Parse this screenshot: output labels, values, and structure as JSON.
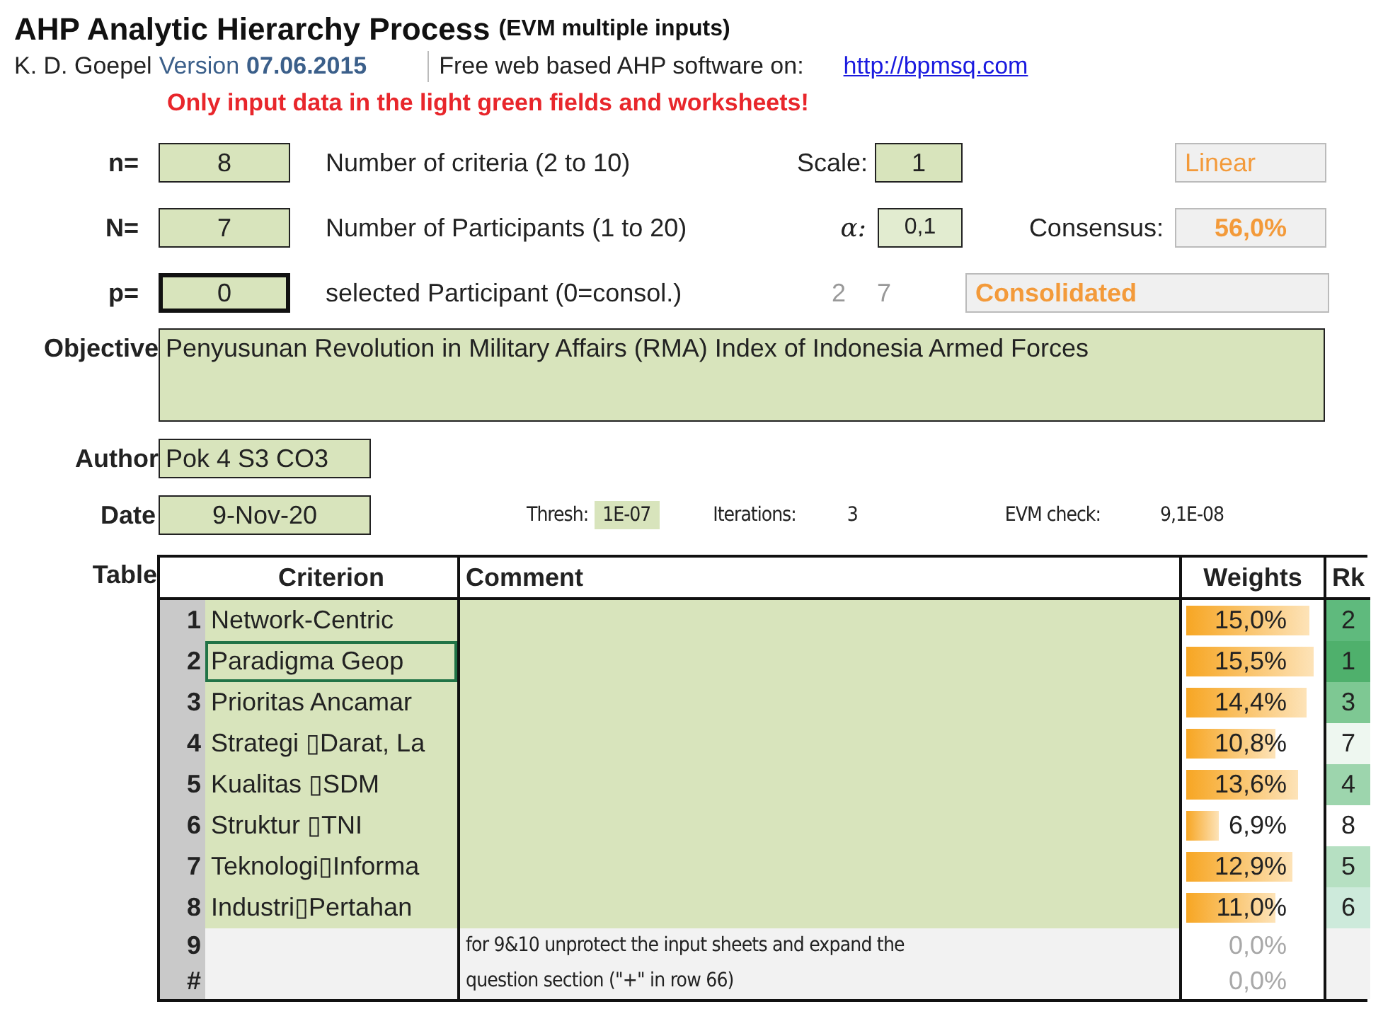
{
  "title": {
    "main": "AHP Analytic Hierarchy Process",
    "sub": "(EVM multiple inputs)"
  },
  "author_line": {
    "author": "K. D. Goepel",
    "version_label": "Version",
    "version": "07.06.2015",
    "software_text": "Free web based AHP software on:",
    "link": "http://bpmsq.com"
  },
  "notice": "Only input data in the light green fields and worksheets!",
  "parameters": [
    {
      "kind": "scale",
      "label": "n=",
      "value": "8",
      "selected": false,
      "description": "Number of criteria (2 to 10)",
      "side_label": "Scale:",
      "side_value": "1",
      "result": "Linear"
    },
    {
      "kind": "alpha",
      "label": "N=",
      "value": "7",
      "selected": false,
      "description": "Number of Participants (1 to 20)",
      "side_label": "α:",
      "side_value": "0,1",
      "result_label": "Consensus:",
      "result": "56,0%"
    },
    {
      "kind": "participant",
      "label": "p=",
      "value": "0",
      "selected": true,
      "description": "selected Participant (0=consol.)",
      "column_1": "2",
      "column_2": "7",
      "result": "Consolidated"
    }
  ],
  "objective": {
    "label": "Objective",
    "value": "Penyusunan Revolution in Military Affairs (RMA) Index of Indonesia Armed Forces"
  },
  "author": {
    "label": "Author",
    "value": "Pok 4 S3 CO3"
  },
  "date": {
    "label": "Date",
    "value": "9-Nov-20"
  },
  "iteration": {
    "thresh_label": "Thresh:",
    "thresh": "1E-07",
    "iterations_label": "Iterations:",
    "iterations": "3",
    "evm_label": "EVM check:",
    "evm": "9,1E-08"
  },
  "table": {
    "label": "Table",
    "columns": [
      "Criterion",
      "Comment",
      "Weights",
      "Rk"
    ],
    "rows": [
      {
        "kind": "input",
        "no": "1",
        "criterion": "Network-Centric",
        "selected": false,
        "weight": "15,0%",
        "level": 0.95,
        "rank": "2",
        "color": "#5fba7d"
      },
      {
        "kind": "input",
        "no": "2",
        "criterion": "Paradigma Geop",
        "selected": true,
        "weight": "15,5%",
        "level": 0.98,
        "rank": "1",
        "color": "#4fb06c"
      },
      {
        "kind": "input",
        "no": "3",
        "criterion": "Prioritas Ancamar",
        "selected": false,
        "weight": "14,4%",
        "level": 0.92,
        "rank": "3",
        "color": "#7ec893"
      },
      {
        "kind": "input",
        "no": "4",
        "criterion": "Strategi ▯Darat, La",
        "selected": false,
        "weight": "10,8%",
        "level": 0.68,
        "rank": "7",
        "color": "#eef7f0"
      },
      {
        "kind": "input",
        "no": "5",
        "criterion": "Kualitas ▯SDM",
        "selected": false,
        "weight": "13,6%",
        "level": 0.86,
        "rank": "4",
        "color": "#9dd5ad"
      },
      {
        "kind": "input",
        "no": "6",
        "criterion": "Struktur ▯TNI",
        "selected": false,
        "weight": "6,9%",
        "level": 0.25,
        "rank": "8",
        "color": "#ffffff"
      },
      {
        "kind": "input",
        "no": "7",
        "criterion": "Teknologi▯Informa",
        "selected": false,
        "weight": "12,9%",
        "level": 0.82,
        "rank": "5",
        "color": "#b6e0c2"
      },
      {
        "kind": "input",
        "no": "8",
        "criterion": "Industri▯Pertahan",
        "selected": false,
        "weight": "11,0%",
        "level": 0.68,
        "rank": "6",
        "color": "#cdeadb"
      },
      {
        "kind": "unused",
        "no": "9",
        "comment": "for 9&10 unprotect the input sheets and expand the",
        "weight": "0,0%"
      },
      {
        "kind": "unused",
        "no": "#",
        "comment": "question section (\"+\" in row 66)",
        "weight": "0,0%"
      }
    ]
  }
}
